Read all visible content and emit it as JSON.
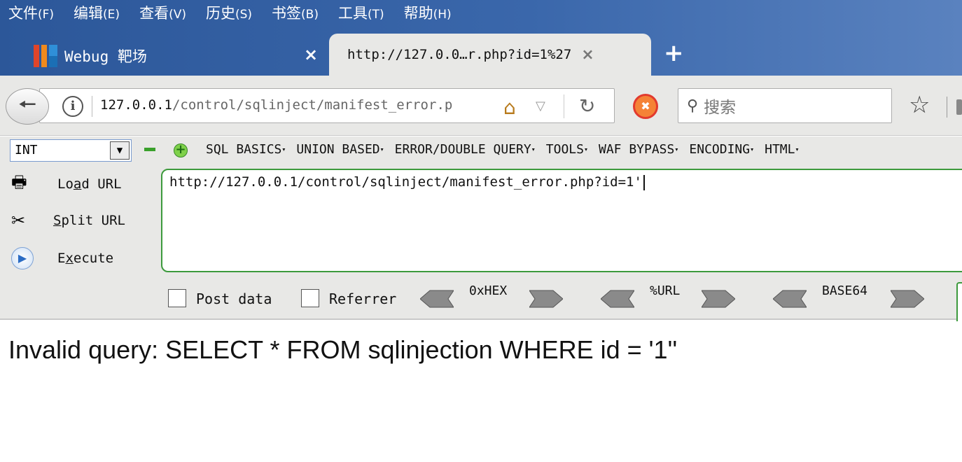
{
  "menubar": {
    "items": [
      {
        "label": "文件",
        "accel": "(F)"
      },
      {
        "label": "编辑",
        "accel": "(E)"
      },
      {
        "label": "查看",
        "accel": "(V)"
      },
      {
        "label": "历史",
        "accel": "(S)"
      },
      {
        "label": "书签",
        "accel": "(B)"
      },
      {
        "label": "工具",
        "accel": "(T)"
      },
      {
        "label": "帮助",
        "accel": "(H)"
      }
    ]
  },
  "tabs": {
    "inactive_title": "Webug 靶场",
    "active_title": "http://127.0.0…r.php?id=1%27",
    "close_glyph": "×",
    "new_tab_glyph": "+"
  },
  "navbar": {
    "url_host": "127.0.0.1",
    "url_path": "/control/sqlinject/manifest_error.p",
    "search_placeholder": "搜索"
  },
  "hackbar": {
    "select_value": "INT",
    "menus": [
      "SQL BASICS",
      "UNION BASED",
      "ERROR/DOUBLE QUERY",
      "TOOLS",
      "WAF BYPASS",
      "ENCODING",
      "HTML"
    ],
    "load_url_pre": "Lo",
    "load_url_acc": "a",
    "load_url_post": "d URL",
    "split_url_acc": "S",
    "split_url_post": "plit URL",
    "execute_pre": "E",
    "execute_acc": "x",
    "execute_post": "ecute",
    "textarea_value": "http://127.0.0.1/control/sqlinject/manifest_error.php?id=1'",
    "post_data_label": "Post data",
    "referrer_label": "Referrer",
    "enc_hex": "0xHEX",
    "enc_url": "%URL",
    "enc_base64": "BASE64",
    "post_data_checked": false,
    "referrer_checked": false
  },
  "content": {
    "error_message": "Invalid query: SELECT * FROM sqlinjection WHERE id = '1''"
  },
  "colors": {
    "frame": "#2c5799",
    "tab_active": "#e8e8e6",
    "hackbar_border": "#3d9a3d"
  }
}
